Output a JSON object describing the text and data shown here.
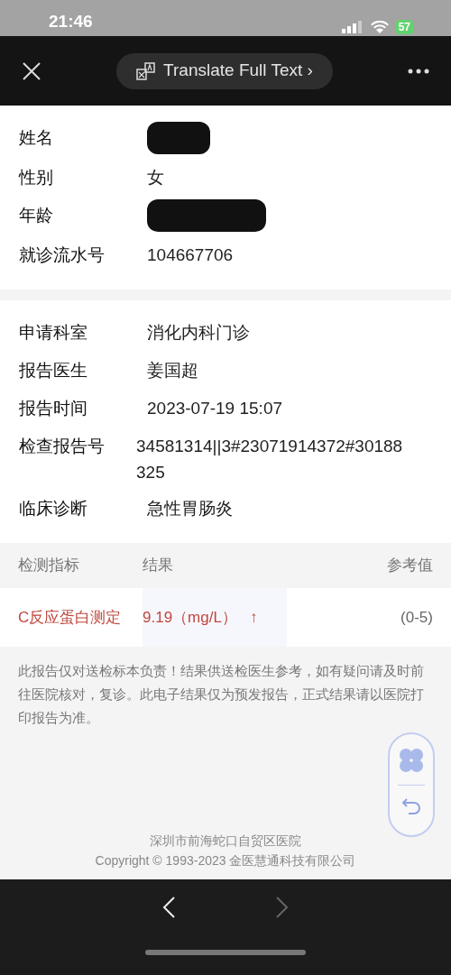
{
  "status_bar": {
    "time": "21:46",
    "battery": "57"
  },
  "header": {
    "translate_button": "Translate Full Text ›"
  },
  "patient": [
    {
      "label": "姓名",
      "kind": "redacted"
    },
    {
      "label": "性别",
      "kind": "text",
      "value": "女"
    },
    {
      "label": "年龄",
      "kind": "redacted"
    },
    {
      "label": "就诊流水号",
      "kind": "text",
      "value": "104667706"
    }
  ],
  "report": [
    {
      "label": "申请科室",
      "value": "消化内科门诊"
    },
    {
      "label": "报告医生",
      "value": "姜国超"
    },
    {
      "label": "报告时间",
      "value": "2023-07-19 15:07"
    },
    {
      "label": "检查报告号",
      "value": "34581314||3#23071914372#30188325"
    },
    {
      "label": "临床诊断",
      "value": "急性胃肠炎"
    }
  ],
  "table": {
    "columns": [
      "检测指标",
      "结果",
      "参考值"
    ],
    "rows": [
      {
        "item": "C反应蛋白测定",
        "result": "9.19（mg/L）",
        "flag": "↑",
        "reference": "(0-5)",
        "abnormal": true
      }
    ]
  },
  "note": "此报告仅对送检标本负责！结果供送检医生参考，如有疑问请及时前往医院核对，复诊。此电子结果仅为预发报告，正式结果请以医院打印报告为准。",
  "footer": [
    "深圳市前海蛇口自贸区医院",
    "Copyright © 1993-2023 金医慧通科技有限公司"
  ]
}
